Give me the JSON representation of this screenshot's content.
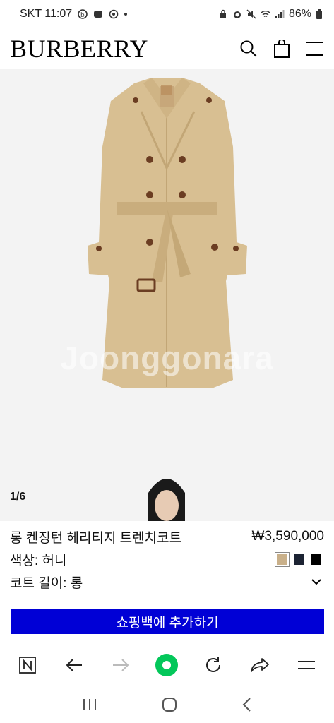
{
  "status": {
    "carrier_time": "SKT 11:07",
    "battery": "86%"
  },
  "header": {
    "logo": "BURBERRY",
    "icons": [
      "search-icon",
      "shopping-bag-icon",
      "menu-icon"
    ]
  },
  "gallery": {
    "counter": "1/6",
    "watermark": "Joonggonara"
  },
  "product": {
    "name": "롱 켄징턴 헤리티지 트렌치코트",
    "price": "₩3,590,000",
    "color_label": "색상: 허니",
    "swatch_colors": [
      "#c9b08a",
      "#1c2333",
      "#000000"
    ],
    "length_label": "코트 길이: 롱",
    "add_to_bag": "쇼핑백에 추가하기",
    "cta_color": "#0000d6"
  },
  "browser_nav": {
    "icons": [
      "naver-n-icon",
      "back-arrow-icon",
      "forward-arrow-icon",
      "home-green-icon",
      "refresh-icon",
      "share-icon",
      "menu-lines-icon"
    ],
    "accent": "#03c75a"
  },
  "system_nav": {
    "icons": [
      "recents-icon",
      "home-icon",
      "back-icon"
    ]
  }
}
